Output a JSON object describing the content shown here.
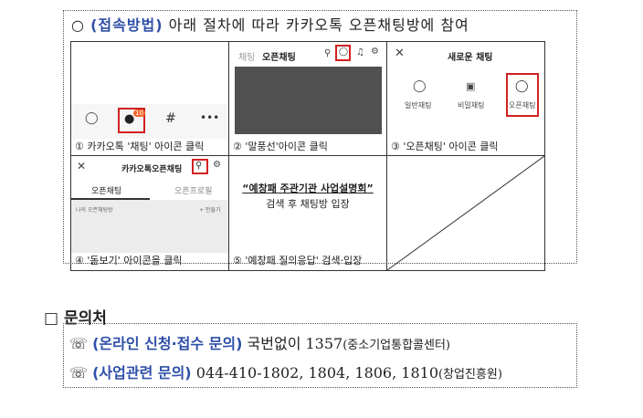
{
  "section1": {
    "bullet": "○",
    "method_label": "(접속방법)",
    "method_text": "아래 절차에 따라 카카오톡 오픈채팅방에 참여"
  },
  "steps": [
    {
      "caption": "① 카카오톡 '채팅' 아이콘 클릭",
      "badge": "10"
    },
    {
      "caption": "② '말풍선'아이콘 클릭",
      "tab_chat": "채팅",
      "tab_open": "오픈채팅"
    },
    {
      "caption": "③ '오픈채팅' 아이콘 클릭",
      "title": "새로운 채팅",
      "options": [
        "일반채팅",
        "비밀채팅",
        "오픈채팅"
      ]
    },
    {
      "caption": "④ '돋보기' 아이콘을 클릭",
      "title": "카카오톡오픈채팅",
      "tab_a": "오픈채팅",
      "tab_b": "오픈프로필",
      "my_rooms": "나의 오픈채팅방",
      "create": "+ 만들기"
    },
    {
      "caption": "⑤ '예창패 질의응답' 검색·입장",
      "quote": "“예창패 주관기관 사업설명회”",
      "search_text": "검색 후 채팅방 입장"
    }
  ],
  "contact": {
    "box": "□",
    "title": "문의처",
    "phone_icon": "☏",
    "rows": [
      {
        "label": "(온라인 신청·접수 문의)",
        "text": "국번없이 1357",
        "note": "(중소기업통합콜센터)"
      },
      {
        "label": "(사업관련 문의)",
        "text": "044-410-1802, 1804, 1806, 1810",
        "note": "(창업진흥원)"
      }
    ]
  },
  "colors": {
    "accent": "#2f4fa8",
    "highlight": "#d32020",
    "badge": "#f0642a",
    "screenshot_dark": "#505050"
  }
}
